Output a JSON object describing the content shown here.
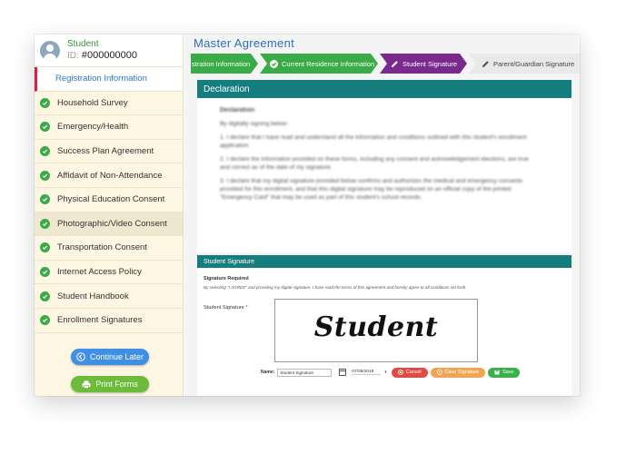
{
  "student": {
    "name": "Student",
    "id_label": "ID:",
    "id_value": "#000000000"
  },
  "sidebar": {
    "items": [
      {
        "label": "Registration Information",
        "state": "active"
      },
      {
        "label": "Household Survey",
        "state": "done"
      },
      {
        "label": "Emergency/Health",
        "state": "done"
      },
      {
        "label": "Success Plan Agreement",
        "state": "done"
      },
      {
        "label": "Affidavit of Non-Attendance",
        "state": "done"
      },
      {
        "label": "Physical Education Consent",
        "state": "done"
      },
      {
        "label": "Photographic/Video Consent",
        "state": "done"
      },
      {
        "label": "Transportation Consent",
        "state": "done"
      },
      {
        "label": "Internet Access Policy",
        "state": "done"
      },
      {
        "label": "Student Handbook",
        "state": "done"
      },
      {
        "label": "Enrollment Signatures",
        "state": "done"
      }
    ],
    "continue_label": "Continue Later",
    "print_label": "Print Forms"
  },
  "main": {
    "title": "Master Agreement",
    "steps": [
      {
        "label": "stration Information",
        "state": "done"
      },
      {
        "label": "Current Residence Information",
        "state": "done"
      },
      {
        "label": "Student Signature",
        "state": "active"
      },
      {
        "label": "Parent/Guardian Signature",
        "state": "pending"
      }
    ]
  },
  "declaration": {
    "header": "Declaration",
    "title": "Declaration",
    "intro": "By digitally signing below:",
    "items": [
      "1. I declare that I have read and understand all the information and conditions outlined with this student's enrollment application",
      "2. I declare the information provided on these forms, including any consent and acknowledgement elections, are true and correct as of the date of my signature.",
      "3. I declare that my digital signature provided below confirms and authorizes the medical and emergency consents provided for this enrollment, and that this digital signature may be reproduced on an official copy of the printed \"Emergency Card\" that may be used as part of this student's school records."
    ]
  },
  "signature": {
    "header": "Student Signature",
    "required_label": "Signature Required",
    "note": "By selecting \"I AGREE\" and providing my digital signature, I have read the terms of this agreement and hereby agree to all conditions set forth.",
    "field_label": "Student Signature",
    "signed_text": "Student",
    "name_label": "Name:",
    "name_value": "Student Signature",
    "date_value": "07/05/2019",
    "cancel_label": "Cancel",
    "clear_label": "Clear Signature",
    "save_label": "Save"
  },
  "colors": {
    "accent_blue": "#2c6fbf",
    "step_green": "#3aab47",
    "step_purple": "#7a2a8e",
    "teal_header": "#167d7f",
    "active_marker": "#d5224a"
  }
}
